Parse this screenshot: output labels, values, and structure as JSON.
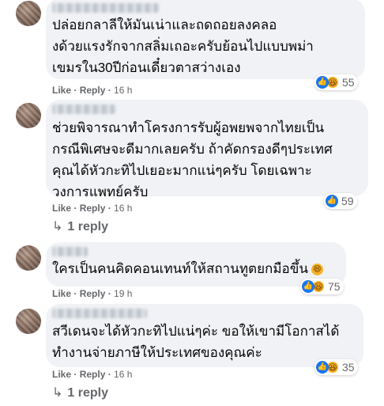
{
  "comments": [
    {
      "text": "ปล่อยกลาลีให้มันเน่าและถดถอยลงคลอ\nงด้วยแรงรักจากสลิ่มเถอะครับย้อนไปแบบพม่า\nเขมรใน30ปีก่อนเดี๋ยวตาสว่างเอง",
      "reaction_count": "55",
      "like": "Like",
      "reply": "Reply",
      "time": "16 h"
    },
    {
      "text": "ช่วยพิจารณาทำโครงการรับผู้อพยพจากไทยเป็น\nกรณีพิเศษจะดีมากเลยครับ ถ้าคัดกรองดีๆประเทศ\nคุณได้หัวกะทิไปเยอะมากแน่ๆครับ โดยเฉพาะ\nวงการแพทย์ครับ",
      "reaction_count": "59",
      "like": "Like",
      "reply": "Reply",
      "time": "16 h",
      "replies_label": "1 reply"
    },
    {
      "text": "ใครเป็นคนคิดคอนเทนท์ให้สถานทูตยกมือขึ้น",
      "reaction_count": "75",
      "like": "Like",
      "reply": "Reply",
      "time": "19 h"
    },
    {
      "text": "สวีเดนจะได้หัวกะทิไปแน่ๆค่ะ ขอให้เขามีโอกาสได้\nทำงานจ่ายภาษีให้ประเทศของคุณค่ะ",
      "reaction_count": "35",
      "like": "Like",
      "reply": "Reply",
      "time": "16 h",
      "replies_label": "1 reply"
    }
  ],
  "separator": " · ",
  "icons": {
    "like": "like-reaction-icon",
    "haha": "haha-reaction-icon",
    "reply_arrow": "reply-arrow-icon",
    "inline_emoji": "grinning-emoji-icon"
  },
  "colors": {
    "bubble": "#f0f2f5",
    "meta": "#65676b",
    "like_blue": "#1877f2",
    "haha_yellow": "#f7b125"
  }
}
